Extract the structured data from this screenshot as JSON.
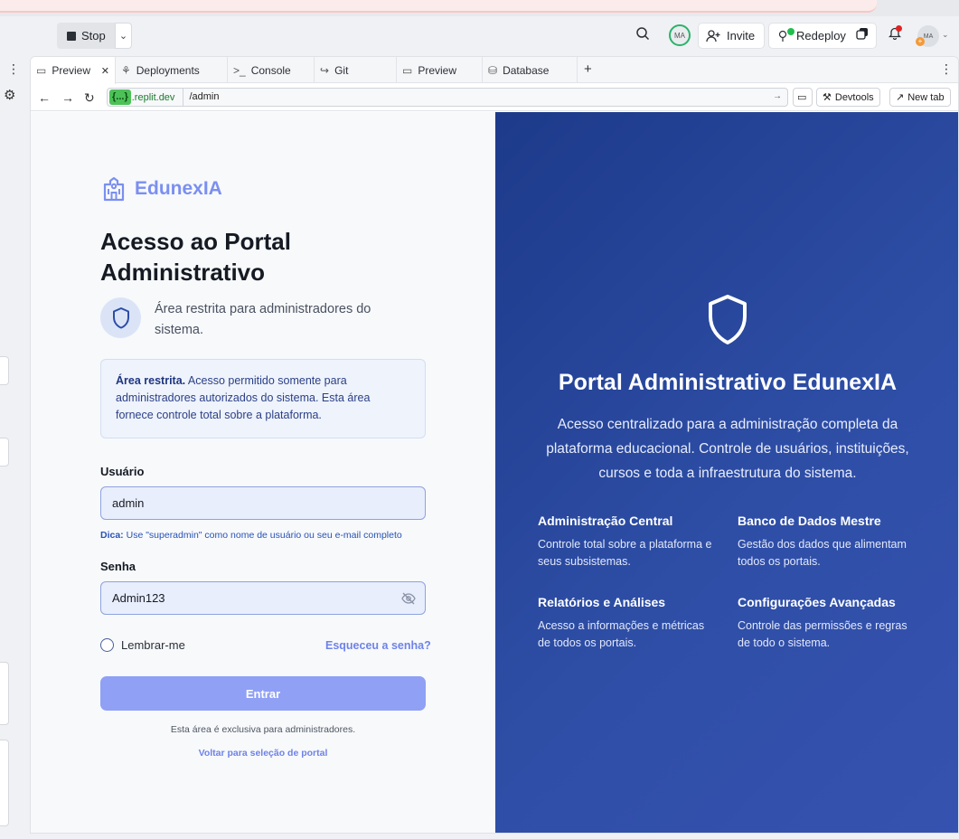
{
  "toolbar": {
    "stop_label": "Stop",
    "avatar_initials": "MA",
    "invite_label": "Invite",
    "redeploy_label": "Redeploy",
    "profile_initials": "MA"
  },
  "tabs": [
    {
      "label": "Preview",
      "icon": "monitor-icon",
      "active": true
    },
    {
      "label": "Deployments",
      "icon": "deploy-icon"
    },
    {
      "label": "Console",
      "icon": "terminal-icon"
    },
    {
      "label": "Git",
      "icon": "git-icon"
    },
    {
      "label": "Preview",
      "icon": "monitor-icon"
    },
    {
      "label": "Database",
      "icon": "database-icon"
    }
  ],
  "urlbar": {
    "host_prefix": "{...}",
    "host": ".replit.dev",
    "path": "/admin",
    "devtools_label": "Devtools",
    "newtab_label": "New tab"
  },
  "login": {
    "brand": "EdunexIA",
    "title": "Acesso ao Portal Administrativo",
    "subtitle": "Área restrita para administradores do sistema.",
    "notice_bold": "Área restrita.",
    "notice_text": " Acesso permitido somente para administradores autorizados do sistema. Esta área fornece controle total sobre a plataforma.",
    "user_label": "Usuário",
    "user_value": "admin",
    "hint_bold": "Dica:",
    "hint_text": " Use \"superadmin\" como nome de usuário ou seu e-mail completo",
    "password_label": "Senha",
    "password_value": "Admin123",
    "remember_label": "Lembrar-me",
    "forgot_label": "Esqueceu a senha?",
    "submit_label": "Entrar",
    "footer_note": "Esta área é exclusiva para administradores.",
    "back_link": "Voltar para seleção de portal"
  },
  "hero": {
    "title": "Portal Administrativo EdunexIA",
    "description": "Acesso centralizado para a administração completa da plataforma educacional. Controle de usuários, instituições, cursos e toda a infraestrutura do sistema.",
    "features": [
      {
        "title": "Administração Central",
        "desc": "Controle total sobre a plataforma e seus subsistemas."
      },
      {
        "title": "Banco de Dados Mestre",
        "desc": "Gestão dos dados que alimentam todos os portais."
      },
      {
        "title": "Relatórios e Análises",
        "desc": "Acesso a informações e métricas de todos os portais."
      },
      {
        "title": "Configurações Avançadas",
        "desc": "Controle das permissões e regras de todo o sistema."
      }
    ]
  },
  "colors": {
    "brand": "#7b8ff0",
    "hero_bg": "#2e4ea6",
    "submit_bg": "#8fa0f5",
    "input_bg": "#e8eefc"
  }
}
